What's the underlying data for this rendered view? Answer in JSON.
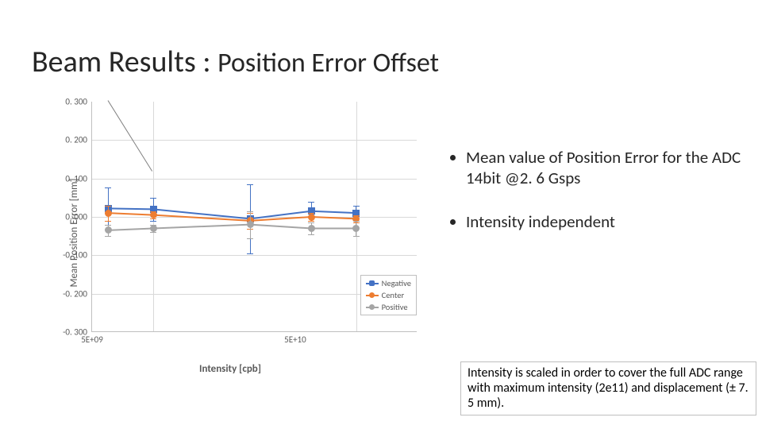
{
  "title_main": "Beam Results : ",
  "title_sub": "Position Error Offset",
  "bullets": [
    "Mean value of Position Error for the ADC 14bit @2. 6 Gsps",
    "Intensity independent"
  ],
  "note": "Intensity is scaled in order to cover the full ADC range with maximum intensity (2e11) and displacement (± 7. 5 mm).",
  "chart_data": {
    "type": "line",
    "xlabel": "Intensity [cpb]",
    "ylabel": "Mean Position Error [mm]",
    "ylim": [
      -0.3,
      0.3
    ],
    "y_ticks": [
      "0. 300",
      "0. 200",
      "0. 100",
      "0. 000",
      "-0. 100",
      "-0. 200",
      "-0. 300"
    ],
    "x_ticks": [
      "5E+09",
      "5E+10"
    ],
    "x_scale": "log",
    "series": [
      {
        "name": "Negative",
        "color": "#4472c4",
        "x": [
          6000000000.0,
          10000000000.0,
          30000000000.0,
          60000000000.0,
          100000000000.0
        ],
        "y": [
          0.022,
          0.02,
          -0.005,
          0.015,
          0.01
        ],
        "yerr": [
          0.055,
          0.03,
          0.09,
          0.025,
          0.02
        ]
      },
      {
        "name": "Center",
        "color": "#ed7d31",
        "x": [
          6000000000.0,
          10000000000.0,
          30000000000.0,
          60000000000.0,
          100000000000.0
        ],
        "y": [
          0.01,
          0.005,
          -0.01,
          0.0,
          -0.005
        ],
        "yerr": [
          0.02,
          0.01,
          0.02,
          0.01,
          0.01
        ]
      },
      {
        "name": "Positive",
        "color": "#a5a5a5",
        "x": [
          6000000000.0,
          10000000000.0,
          30000000000.0,
          60000000000.0,
          100000000000.0
        ],
        "y": [
          -0.035,
          -0.03,
          -0.02,
          -0.03,
          -0.03
        ],
        "yerr": [
          0.015,
          0.01,
          0.035,
          0.015,
          0.02
        ]
      }
    ]
  }
}
